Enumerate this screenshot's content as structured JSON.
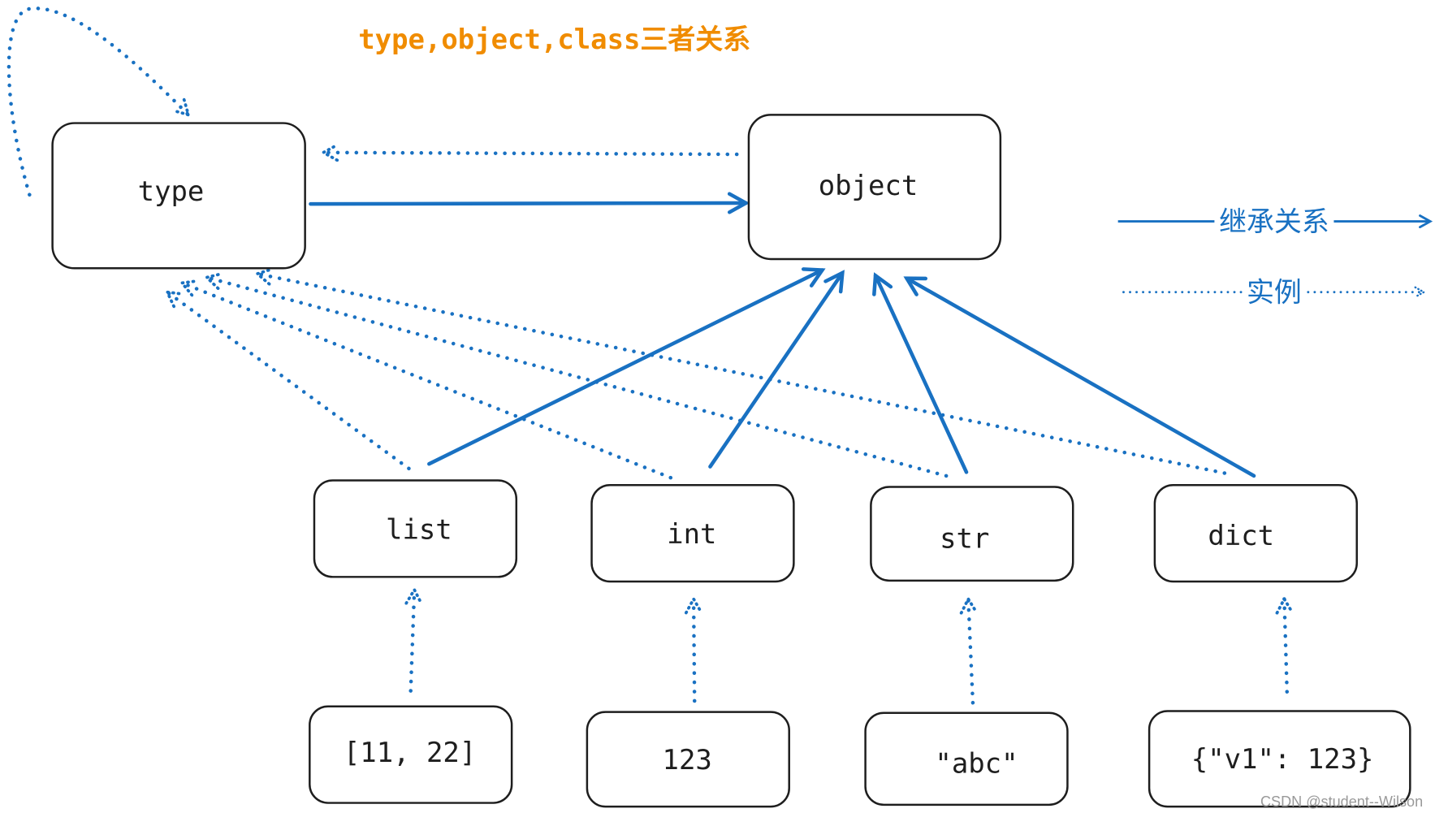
{
  "title": "type,object,class三者关系",
  "nodes": {
    "type": "type",
    "object": "object",
    "list": "list",
    "int": "int",
    "str": "str",
    "dict": "dict",
    "list_instance": "[11, 22]",
    "int_instance": "123",
    "str_instance": "\"abc\"",
    "dict_instance": "{\"v1\": 123}"
  },
  "legend": {
    "inheritance": "继承关系",
    "instance": "实例"
  },
  "relations": {
    "inheritance": [
      [
        "type",
        "object"
      ],
      [
        "list",
        "object"
      ],
      [
        "int",
        "object"
      ],
      [
        "str",
        "object"
      ],
      [
        "dict",
        "object"
      ]
    ],
    "instance": [
      [
        "type",
        "type"
      ],
      [
        "object",
        "type"
      ],
      [
        "list",
        "type"
      ],
      [
        "int",
        "type"
      ],
      [
        "str",
        "type"
      ],
      [
        "dict",
        "type"
      ],
      [
        "[11, 22]",
        "list"
      ],
      [
        "123",
        "int"
      ],
      [
        "\"abc\"",
        "str"
      ],
      [
        "{\"v1\": 123}",
        "dict"
      ]
    ]
  },
  "colors": {
    "arrow": "#1971c2",
    "title": "#f08c00",
    "stroke": "#1e1e1e"
  },
  "watermark": "CSDN @student--Wilson"
}
